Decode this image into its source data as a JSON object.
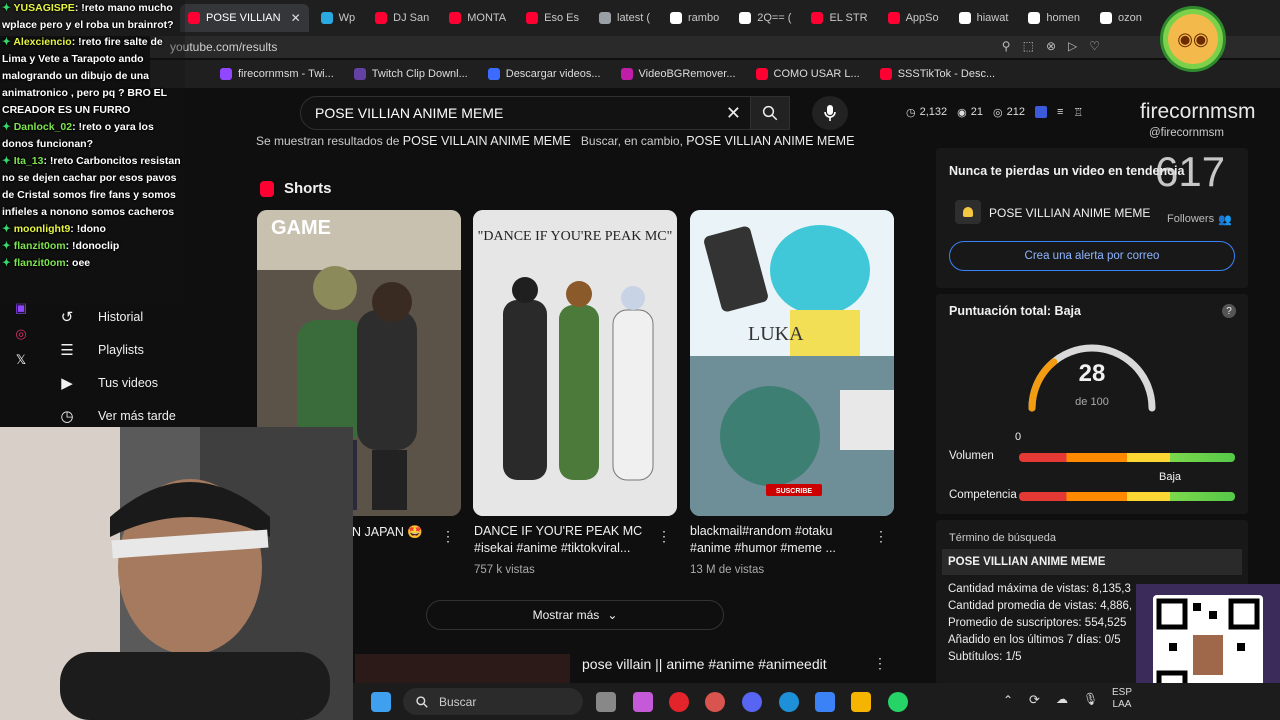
{
  "browser": {
    "tabs": [
      {
        "label": "POSE VILLIAN",
        "active": true,
        "color": "#ff0033"
      },
      {
        "label": "Wp",
        "active": false,
        "color": "#2aa8e0"
      },
      {
        "label": "DJ San",
        "active": false,
        "color": "#ff0033"
      },
      {
        "label": "MONTA",
        "active": false,
        "color": "#ff0033"
      },
      {
        "label": "Eso Es",
        "active": false,
        "color": "#ff0033"
      },
      {
        "label": "latest (",
        "active": false,
        "color": "#9aa0a6"
      },
      {
        "label": "rambo",
        "active": false,
        "color": "#ffffff"
      },
      {
        "label": "2Q== (",
        "active": false,
        "color": "#ffffff"
      },
      {
        "label": "EL STR",
        "active": false,
        "color": "#ff0033"
      },
      {
        "label": "AppSo",
        "active": false,
        "color": "#ff0033"
      },
      {
        "label": "hiawat",
        "active": false,
        "color": "#ffffff"
      },
      {
        "label": "homen",
        "active": false,
        "color": "#ffffff"
      },
      {
        "label": "ozon",
        "active": false,
        "color": "#ffffff"
      }
    ],
    "address": "youtube.com/results",
    "bookmarks": [
      {
        "label": "firecornmsm - Twi...",
        "color": "#9146ff"
      },
      {
        "label": "Twitch Clip Downl...",
        "color": "#6441a5"
      },
      {
        "label": "Descargar videos...",
        "color": "#3b6cff"
      },
      {
        "label": "VideoBGRemover...",
        "color": "#c01ea8"
      },
      {
        "label": "COMO USAR L...",
        "color": "#ff0033"
      },
      {
        "label": "SSSTikTok - Desc...",
        "color": "#ff0033"
      }
    ]
  },
  "search": {
    "query": "POSE VILLIAN ANIME MEME",
    "notice_prefix": "Se muestran resultados de",
    "notice_corrected": "POSE VILLAIN ANIME MEME",
    "notice_alt": "Buscar, en cambio,",
    "notice_original": "POSE VILLIAN ANIME MEME"
  },
  "stats": {
    "views": "2,132",
    "eye": "21",
    "watch": "212"
  },
  "sidebar": {
    "items": [
      {
        "label": "Historial",
        "icon": "history-icon"
      },
      {
        "label": "Playlists",
        "icon": "playlists-icon"
      },
      {
        "label": "Tus videos",
        "icon": "your-videos-icon"
      },
      {
        "label": "Ver más tarde",
        "icon": "watch-later-icon"
      }
    ]
  },
  "chat": [
    {
      "user": "YUSAGISPE",
      "text": ": !reto mano mucho wplace pero y el roba un brainrot?",
      "green": false
    },
    {
      "user": "Alexciencio",
      "text": ": !reto fire salte de Lima y Vete a Tarapoto ando malogrando un dibujo de una animatronico , pero pq ? BRO EL CREADOR ES UN FURRO",
      "green": false
    },
    {
      "user": "Danlock_02",
      "text": ": !reto o yara los donos funcionan?",
      "green": true
    },
    {
      "user": "Ita_13",
      "text": ": !reto Carboncitos resistan no se dejen cachar por esos pavos de Cristal somos fire fans y somos infieles a nonono somos cacheros",
      "green": true
    },
    {
      "user": "moonlight9",
      "text": ": !dono",
      "green": false
    },
    {
      "user": "flanzit0om",
      "text": ": !donoclip",
      "green": true
    },
    {
      "user": "flanzit0om",
      "text": ": oee",
      "green": true
    }
  ],
  "shorts": {
    "heading": "Shorts",
    "items": [
      {
        "title": "N JAPAN 🤩",
        "meta": "",
        "overlay": "GAME"
      },
      {
        "title": "DANCE IF YOU'RE PEAK MC #isekai #anime #tiktokviral...",
        "meta": "757 k vistas",
        "overlay": "\"DANCE IF YOU'RE PEAK MC\""
      },
      {
        "title": "blackmail#random #otaku #anime #humor #meme ...",
        "meta": "13 M de vistas",
        "overlay": "LUKA"
      }
    ],
    "more_label": "Mostrar más"
  },
  "video_row": {
    "title": "pose villain || anime #anime #animeedit"
  },
  "streamer": {
    "name": "firecornmsm",
    "handle": "@firecornmsm",
    "followers_label": "Followers",
    "count": "617"
  },
  "panel": {
    "trend_title": "Nunca te pierdas un video en tendencia",
    "trend_query": "POSE VILLIAN ANIME MEME",
    "alert_button": "Crea una alerta por correo",
    "score_title": "Puntuación total: Baja",
    "score": {
      "value": 28,
      "max_label": "de 100",
      "max": 100
    },
    "volume_label": "Volumen",
    "volume_value": "0",
    "competition_label": "Competencia",
    "competition_value": "Baja",
    "term_label": "Término de búsqueda",
    "term_value": "POSE VILLIAN ANIME MEME",
    "metrics": [
      {
        "label": "Cantidad máxima de vistas:",
        "value": "8,135,3"
      },
      {
        "label": "Cantidad promedia de vistas:",
        "value": "4,886,"
      },
      {
        "label": "Promedio de suscriptores:",
        "value": "554,525"
      },
      {
        "label": "Añadido en los últimos 7 días:",
        "value": "0/5"
      },
      {
        "label": "Subtítulos:",
        "value": "1/5"
      }
    ],
    "colors": {
      "gauge": "#f39c12",
      "accent": "#3b82f6"
    }
  },
  "taskbar": {
    "search_label": "Buscar",
    "lang": "ESP",
    "region": "LAA"
  },
  "qr_badge": "SUSCRIBE"
}
